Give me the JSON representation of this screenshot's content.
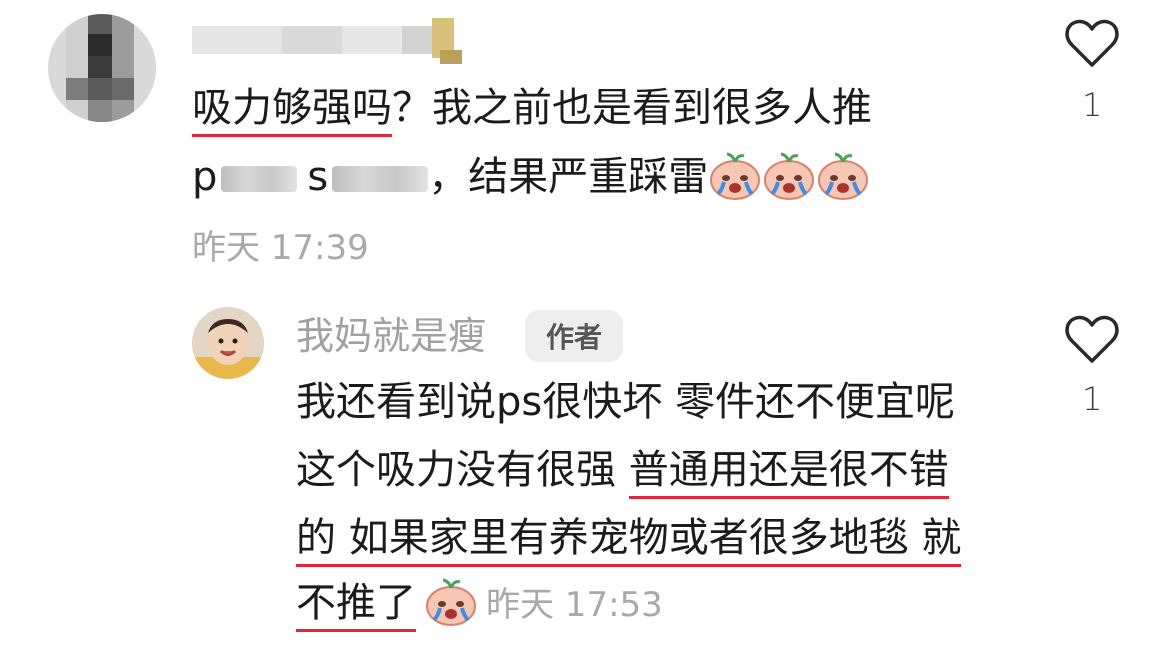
{
  "comment": {
    "username": "",
    "line1": "吸力够强吗？我之前也是看到很多人推",
    "line1_underlined": "吸力够强吗",
    "line1_rest": "？我之前也是看到很多人推",
    "line2_p": "p",
    "line2_s": "s",
    "line2_rest": "，结果严重踩雷",
    "time": "昨天 17:39",
    "likes": "1"
  },
  "reply": {
    "author": "我妈就是瘦",
    "badge": "作者",
    "line1": "我还看到说ps很快坏 零件还不便宜呢",
    "line2_a": "这个吸力没有很强 ",
    "line2_b": "普通用还是很不错",
    "line3": "的 如果家里有养宠物或者很多地毯 就",
    "line4": "不推了",
    "time": "昨天 17:53",
    "likes": "1"
  },
  "colors": {
    "underline": "#e0283c",
    "meta_gray": "#a9a9a9"
  },
  "icons": [
    "heart-outline-icon",
    "crying-emoji-icon"
  ]
}
